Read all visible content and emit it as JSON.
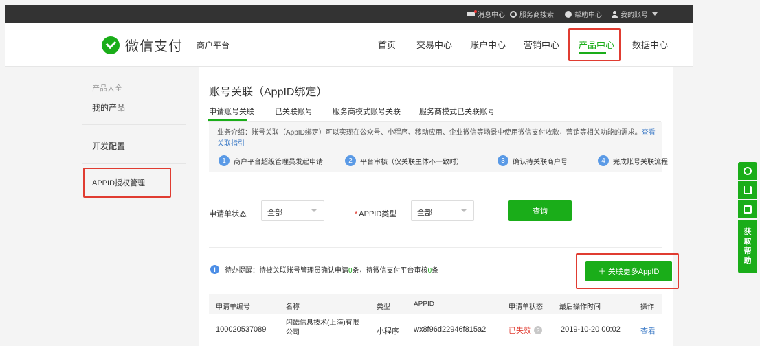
{
  "topbar": {
    "messages": "消息中心",
    "service_search": "服务商搜索",
    "help": "帮助中心",
    "account": "我的账号"
  },
  "header": {
    "brand": "微信支付",
    "platform": "商户平台",
    "nav": [
      "首页",
      "交易中心",
      "账户中心",
      "营销中心",
      "产品中心",
      "数据中心"
    ],
    "active_nav": "产品中心"
  },
  "sidebar": {
    "group_label": "产品大全",
    "items": [
      "我的产品",
      "开发配置",
      "APPID授权管理"
    ],
    "active_item": "APPID授权管理"
  },
  "main": {
    "title": "账号关联（AppID绑定）",
    "tabs": [
      "申请账号关联",
      "已关联账号",
      "服务商模式账号关联",
      "服务商模式已关联账号"
    ],
    "intro": {
      "text": "业务介绍：账号关联（AppID绑定）可以实现在公众号、小程序、移动应用、企业微信等场景中使用微信支付收款，营销等相关功能的需求。",
      "link": "查看关联指引"
    },
    "steps": [
      {
        "num": "1",
        "label": "商户平台超级管理员发起申请"
      },
      {
        "num": "2",
        "label": "平台审核（仅关联主体不一致时）"
      },
      {
        "num": "3",
        "label": "确认待关联商户号"
      },
      {
        "num": "4",
        "label": "完成账号关联流程"
      }
    ],
    "filters": {
      "status_label": "申请单状态",
      "status_value": "全部",
      "type_required": "*",
      "type_label": "APPID类型",
      "type_value": "全部",
      "query_button": "查询"
    },
    "notice": {
      "icon": "i",
      "text_a": "待办提醒：待被关联账号管理员确认申请",
      "count_a": "0",
      "text_b": "条，待微信支付平台审核",
      "count_b": "0",
      "text_c": "条"
    },
    "add_button": "＋ 关联更多AppID",
    "table": {
      "headers": [
        "申请单编号",
        "名称",
        "类型",
        "APPID",
        "申请单状态",
        "最后操作时间",
        "操作"
      ],
      "rows": [
        {
          "id": "100020537089",
          "name_line1": "闪酷信息技术(上海)有限",
          "name_line2": "公司",
          "type": "小程序",
          "appid": "wx8f96d22946f815a2",
          "status": "已失效",
          "time": "2019-10-20 00:02",
          "action": "查看"
        }
      ]
    }
  },
  "float_toolbar": {
    "help_label": "获取帮助"
  },
  "colors": {
    "brand_green": "#1aad19",
    "highlight_red": "#e03c31",
    "link_blue": "#3a79c6"
  }
}
